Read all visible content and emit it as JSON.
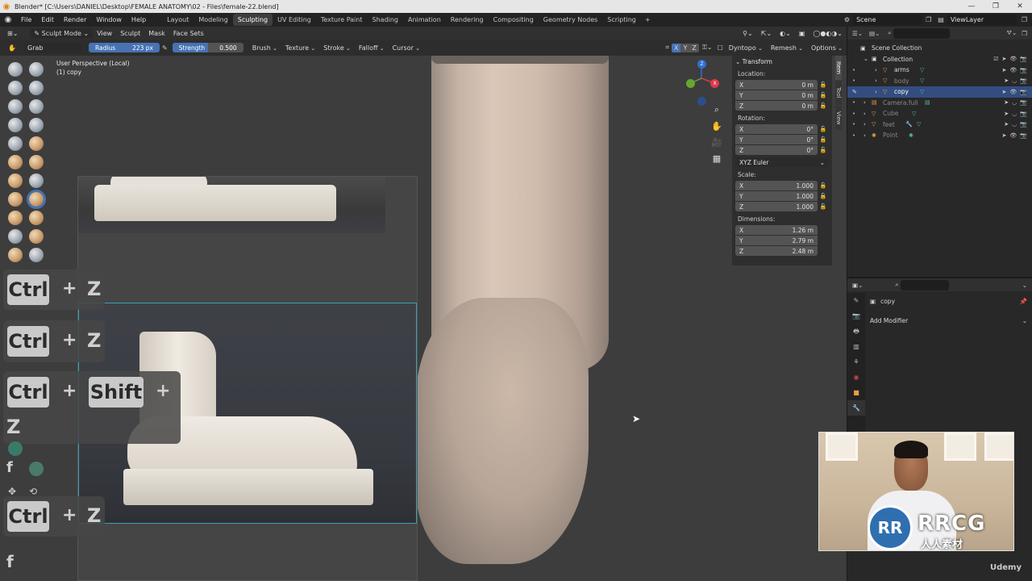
{
  "titlebar": {
    "title": "Blender* [C:\\Users\\DANIEL\\Desktop\\FEMALE ANATOMY\\02 - Files\\female-22.blend]",
    "minimize": "—",
    "maximize": "❐",
    "close": "✕"
  },
  "menu": [
    "File",
    "Edit",
    "Render",
    "Window",
    "Help"
  ],
  "workspaces": [
    "Layout",
    "Modeling",
    "Sculpting",
    "UV Editing",
    "Texture Paint",
    "Shading",
    "Animation",
    "Rendering",
    "Compositing",
    "Geometry Nodes",
    "Scripting"
  ],
  "active_workspace": "Sculpting",
  "scene": "Scene",
  "view_layer": "ViewLayer",
  "header": {
    "mode": "Sculpt Mode",
    "menus": [
      "View",
      "Sculpt",
      "Mask",
      "Face Sets"
    ],
    "right": [
      "Dyntopo",
      "Remesh",
      "Options"
    ]
  },
  "toolsettings": {
    "brush": "Grab",
    "radius_label": "Radius",
    "radius_value": "223 px",
    "strength_label": "Strength",
    "strength_value": "0.500",
    "strength_fraction": 0.5,
    "dropdowns": [
      "Brush",
      "Texture",
      "Stroke",
      "Falloff",
      "Cursor"
    ],
    "axes": [
      "X",
      "Y",
      "Z"
    ]
  },
  "viewport": {
    "info_line1": "User Perspective (Local)",
    "info_line2": "(1) copy"
  },
  "keys": {
    "ctrl": "Ctrl",
    "shift": "Shift",
    "plus": "+",
    "z": "Z",
    "f": "f"
  },
  "gizmo": {
    "x": "X",
    "y": "Y",
    "z": "Z"
  },
  "npanel": {
    "tabs": [
      "Item",
      "Tool",
      "View"
    ],
    "transform": "Transform",
    "location_label": "Location:",
    "location": [
      [
        "X",
        "0 m"
      ],
      [
        "Y",
        "0 m"
      ],
      [
        "Z",
        "0 m"
      ]
    ],
    "rotation_label": "Rotation:",
    "rotation": [
      [
        "X",
        "0°"
      ],
      [
        "Y",
        "0°"
      ],
      [
        "Z",
        "0°"
      ]
    ],
    "euler": "XYZ Euler",
    "scale_label": "Scale:",
    "scale": [
      [
        "X",
        "1.000"
      ],
      [
        "Y",
        "1.000"
      ],
      [
        "Z",
        "1.000"
      ]
    ],
    "dimensions_label": "Dimensions:",
    "dimensions": [
      [
        "X",
        "1.26 m"
      ],
      [
        "Y",
        "2.79 m"
      ],
      [
        "Z",
        "2.48 m"
      ]
    ]
  },
  "outliner": {
    "root": "Scene Collection",
    "collection": "Collection",
    "items": [
      "arms",
      "body",
      "copy",
      "Camera.full",
      "Cube",
      "feet",
      "Point"
    ]
  },
  "properties": {
    "object": "copy",
    "add_modifier": "Add Modifier"
  },
  "webcam": {
    "brand": "RRCG",
    "brand_sub": "人人素材",
    "logo": "RR"
  },
  "watermark": "Udemy",
  "colors": {
    "accent": "#4772b3",
    "selected": "#334d80",
    "mesh": "#cbb8a9",
    "gizmo_x": "#e0384c",
    "gizmo_y": "#6aa432",
    "gizmo_z": "#2f6fd0"
  }
}
